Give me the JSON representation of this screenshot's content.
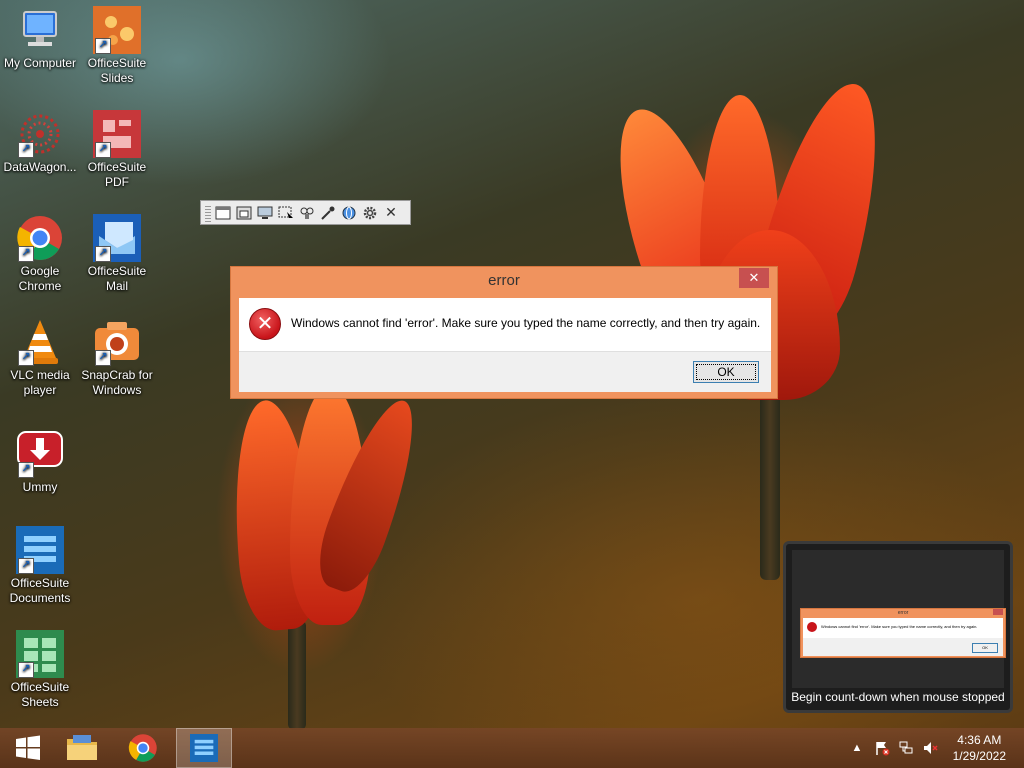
{
  "desktop": {
    "icons": [
      {
        "label": "My Computer",
        "icon": "computer-icon"
      },
      {
        "label": "OfficeSuite Slides",
        "icon": "slides-icon"
      },
      {
        "label": "DataWagon...",
        "icon": "datawagon-icon"
      },
      {
        "label": "OfficeSuite PDF",
        "icon": "pdf-icon"
      },
      {
        "label": "Google Chrome",
        "icon": "chrome-icon"
      },
      {
        "label": "OfficeSuite Mail",
        "icon": "mail-icon"
      },
      {
        "label": "VLC media player",
        "icon": "vlc-icon"
      },
      {
        "label": "SnapCrab for Windows",
        "icon": "snapcrab-icon"
      },
      {
        "label": "Ummy",
        "icon": "ummy-icon"
      },
      {
        "label": "OfficeSuite Documents",
        "icon": "documents-icon"
      },
      {
        "label": "OfficeSuite Sheets",
        "icon": "sheets-icon"
      }
    ]
  },
  "toolbar": {
    "close_glyph": "✕"
  },
  "dialog": {
    "title": "error",
    "close_glyph": "✕",
    "message": "Windows cannot find 'error'. Make sure you typed the name correctly, and then try again.",
    "ok_label": "OK"
  },
  "preview": {
    "mini_title": "error",
    "mini_message": "Windows cannot find 'error'. Make sure you typed the name correctly, and then try again.",
    "mini_ok": "OK",
    "label": "Begin count-down when mouse stopped"
  },
  "taskbar": {
    "time": "4:36 AM",
    "date": "1/29/2022",
    "tray_up": "▲"
  },
  "colors": {
    "dialog_frame": "#f0935e",
    "close_red": "#c75050",
    "error_red": "#c8141a"
  }
}
